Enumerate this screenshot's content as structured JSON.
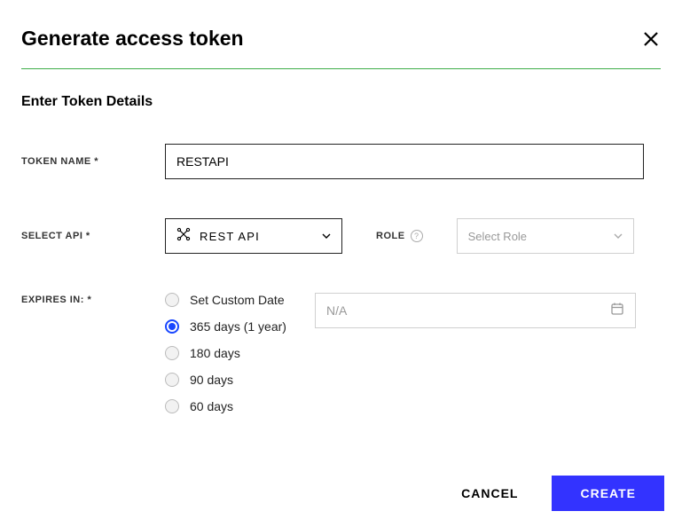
{
  "header": {
    "title": "Generate access token"
  },
  "subtitle": "Enter Token Details",
  "form": {
    "tokenName": {
      "label": "TOKEN NAME *",
      "value": "RESTAPI"
    },
    "selectApi": {
      "label": "SELECT API *",
      "value": "REST API"
    },
    "role": {
      "label": "ROLE",
      "placeholder": "Select Role"
    },
    "expires": {
      "label": "EXPIRES IN: *",
      "options": [
        {
          "label": "Set Custom Date",
          "selected": false
        },
        {
          "label": "365 days (1 year)",
          "selected": true
        },
        {
          "label": "180 days",
          "selected": false
        },
        {
          "label": "90 days",
          "selected": false
        },
        {
          "label": "60 days",
          "selected": false
        }
      ],
      "customDatePlaceholder": "N/A"
    }
  },
  "footer": {
    "cancel": "CANCEL",
    "create": "CREATE"
  }
}
